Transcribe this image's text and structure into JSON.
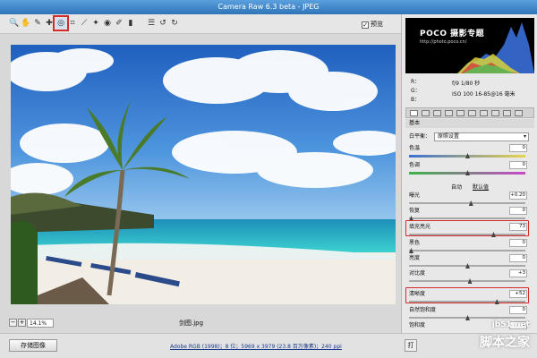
{
  "window": {
    "title": "Camera Raw 6.3 beta - JPEG"
  },
  "toolbar": {
    "tools": [
      {
        "name": "zoom-tool",
        "icon": "magnifier-icon",
        "glyph": "🔍"
      },
      {
        "name": "hand-tool",
        "icon": "hand-icon",
        "glyph": "✋"
      },
      {
        "name": "white-balance-tool",
        "icon": "eyedropper-icon",
        "glyph": "✎"
      },
      {
        "name": "color-sampler-tool",
        "icon": "sampler-icon",
        "glyph": "✚"
      },
      {
        "name": "targeted-adjustment-tool",
        "icon": "target-adjust-icon",
        "glyph": "◎"
      },
      {
        "name": "crop-tool",
        "icon": "crop-icon",
        "glyph": "⌗"
      },
      {
        "name": "straighten-tool",
        "icon": "straighten-icon",
        "glyph": "⟋"
      },
      {
        "name": "spot-removal-tool",
        "icon": "spot-icon",
        "glyph": "✦"
      },
      {
        "name": "red-eye-tool",
        "icon": "eye-icon",
        "glyph": "◉"
      },
      {
        "name": "adjustment-brush-tool",
        "icon": "brush-icon",
        "glyph": "✐"
      },
      {
        "name": "graduated-filter-tool",
        "icon": "gradient-icon",
        "glyph": "▮"
      },
      {
        "name": "preferences-tool",
        "icon": "list-icon",
        "glyph": "☰"
      },
      {
        "name": "rotate-left-tool",
        "icon": "rotate-ccw-icon",
        "glyph": "↺"
      },
      {
        "name": "rotate-right-tool",
        "icon": "rotate-cw-icon",
        "glyph": "↻"
      }
    ],
    "selected_index": 4,
    "preview_label": "预览",
    "preview_checked": true
  },
  "histogram": {
    "logo_text": "POCO 摄影专题",
    "logo_url": "http://photo.poco.cn/"
  },
  "info": {
    "rgb_labels": [
      "R：",
      "G：",
      "B："
    ],
    "aperture": "f/9  1/80 秒",
    "iso": "ISO 100   16-85@16 毫米"
  },
  "panel": {
    "section_title": "基本",
    "white_balance_label": "白平衡：",
    "white_balance_value": "原照设置",
    "auto_label": "自动",
    "default_label": "默认值",
    "sliders": [
      {
        "label": "色温",
        "value": "0",
        "pos": 0.5,
        "track": "temp"
      },
      {
        "label": "色调",
        "value": "0",
        "pos": 0.5,
        "track": "tint"
      },
      {
        "label": "曝光",
        "value": "+0.20",
        "pos": 0.53,
        "track": "plain"
      },
      {
        "label": "恢复",
        "value": "0",
        "pos": 0.0,
        "track": "plain"
      },
      {
        "label": "填充亮光",
        "value": "73",
        "pos": 0.73,
        "track": "plain",
        "highlight": true
      },
      {
        "label": "黑色",
        "value": "0",
        "pos": 0.0,
        "track": "plain"
      },
      {
        "label": "亮度",
        "value": "0",
        "pos": 0.5,
        "track": "plain"
      },
      {
        "label": "对比度",
        "value": "+3",
        "pos": 0.52,
        "track": "plain"
      },
      {
        "label": "清晰度",
        "value": "+52",
        "pos": 0.76,
        "track": "plain",
        "highlight": true
      },
      {
        "label": "自然饱和度",
        "value": "0",
        "pos": 0.5,
        "track": "plain"
      },
      {
        "label": "饱和度",
        "value": "0",
        "pos": 0.5,
        "track": "plain"
      }
    ]
  },
  "viewer": {
    "zoom": "14.1%",
    "filename": "剑图.jpg"
  },
  "footer": {
    "save_label": "存储图像",
    "metadata": "Adobe RGB (1998)；8 位；5969 x 3979 (23.8 百万像素)；240 ppi",
    "open_label": "打"
  },
  "watermark": {
    "url": "jb51.net",
    "name": "脚本之家"
  }
}
